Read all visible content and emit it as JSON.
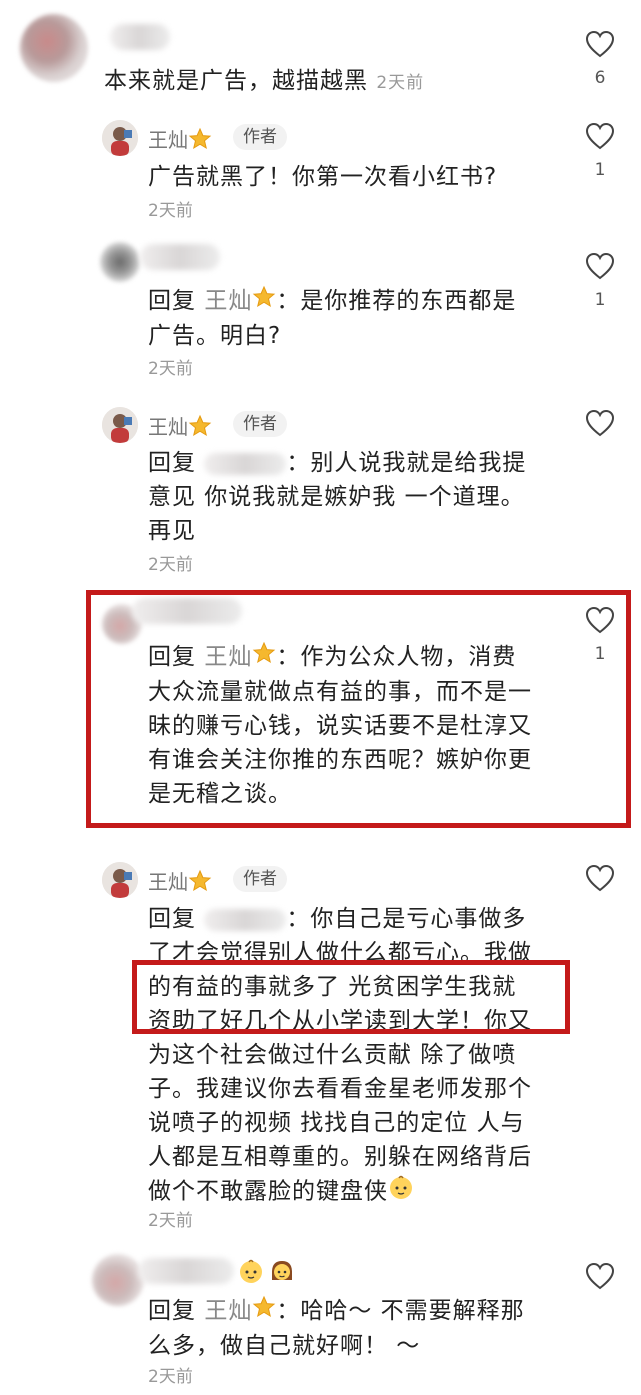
{
  "comments": [
    {
      "text": "本来就是广告，越描越黑",
      "time": "2天前",
      "likes": "6"
    },
    {
      "author": "王灿",
      "badge": "作者",
      "text": "广告就黑了！你第一次看小红书?",
      "time": "2天前",
      "likes": "1"
    },
    {
      "reply_label": "回复",
      "reply_to": "王灿",
      "text_line1": "：是你推荐的东西都是",
      "text_line2": "广告。明白?",
      "time": "2天前",
      "likes": "1"
    },
    {
      "author": "王灿",
      "badge": "作者",
      "reply_label": "回复",
      "text_line1": "：别人说我就是给我提",
      "text_line2": "意见 你说我就是嫉妒我 一个道理。",
      "text_line3": "再见",
      "time": "2天前"
    },
    {
      "reply_label": "回复",
      "reply_to": "王灿",
      "text_line1": "：作为公众人物，消费",
      "text_line2": "大众流量就做点有益的事，而不是一",
      "text_line3": "昧的赚亏心钱，说实话要不是杜淳又",
      "text_line4": "有谁会关注你推的东西呢？嫉妒你更",
      "text_line5": "是无稽之谈。",
      "likes": "1"
    },
    {
      "author": "王灿",
      "badge": "作者",
      "reply_label": "回复",
      "text_line1": "：你自己是亏心事做多",
      "text_line2": "了才会觉得别人做什么都亏心。我做",
      "text_line3": "的有益的事就多了 光贫困学生我就",
      "text_line4": "资助了好几个从小学读到大学！你又",
      "text_line5": "为这个社会做过什么贡献 除了做喷",
      "text_line6": "子。我建议你去看看金星老师发那个",
      "text_line7": "说喷子的视频 找找自己的定位 人与",
      "text_line8": "人都是互相尊重的。别躲在网络背后",
      "text_line9": "做个不敢露脸的键盘侠",
      "time": "2天前"
    },
    {
      "reply_label": "回复",
      "reply_to": "王灿",
      "text": "：哈哈～ 不需要解释那",
      "text_line2": "么多，做自己就好啊！ ～",
      "time": "2天前"
    }
  ],
  "icons": {
    "like": "heart-outline-icon",
    "star": "star-emoji-icon",
    "baby": "baby-emoji-icon",
    "girl": "girl-emoji-icon"
  },
  "colors": {
    "highlight_box": "#c41a1a",
    "text": "#222222",
    "muted": "#999999"
  }
}
